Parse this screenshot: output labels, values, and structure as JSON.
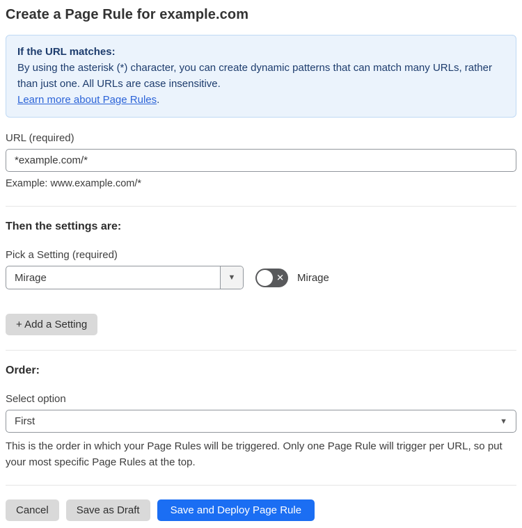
{
  "page": {
    "title": "Create a Page Rule for example.com"
  },
  "info_box": {
    "heading": "If the URL matches:",
    "body": "By using the asterisk (*) character, you can create dynamic patterns that can match many URLs, rather than just one. All URLs are case insensitive.",
    "link_label": "Learn more about Page Rules",
    "link_suffix": "."
  },
  "url_field": {
    "label": "URL (required)",
    "value": "*example.com/*",
    "helper": "Example: www.example.com/*"
  },
  "settings_section": {
    "heading": "Then the settings are:",
    "setting_label": "Pick a Setting (required)",
    "setting_value": "Mirage",
    "toggle_label": "Mirage",
    "toggle_state": "off",
    "add_setting_label": "+ Add a Setting"
  },
  "order_section": {
    "heading": "Order:",
    "select_label": "Select option",
    "select_value": "First",
    "helper": "This is the order in which your Page Rules will be triggered. Only one Page Rule will trigger per URL, so put your most specific Page Rules at the top."
  },
  "footer": {
    "cancel_label": "Cancel",
    "save_draft_label": "Save as Draft",
    "save_deploy_label": "Save and Deploy Page Rule"
  },
  "icons": {
    "combo_arrow": "▼",
    "select_arrow": "▼",
    "toggle_x": "✕"
  },
  "colors": {
    "info_box_bg": "#ebf3fc",
    "info_box_border": "#bfd9f4",
    "info_text": "#1d3c6d",
    "link": "#2c64d8",
    "primary_button": "#1b6ef3",
    "gray_button": "#d9d9d9",
    "toggle_off": "#58595b",
    "input_border": "#91969c"
  }
}
